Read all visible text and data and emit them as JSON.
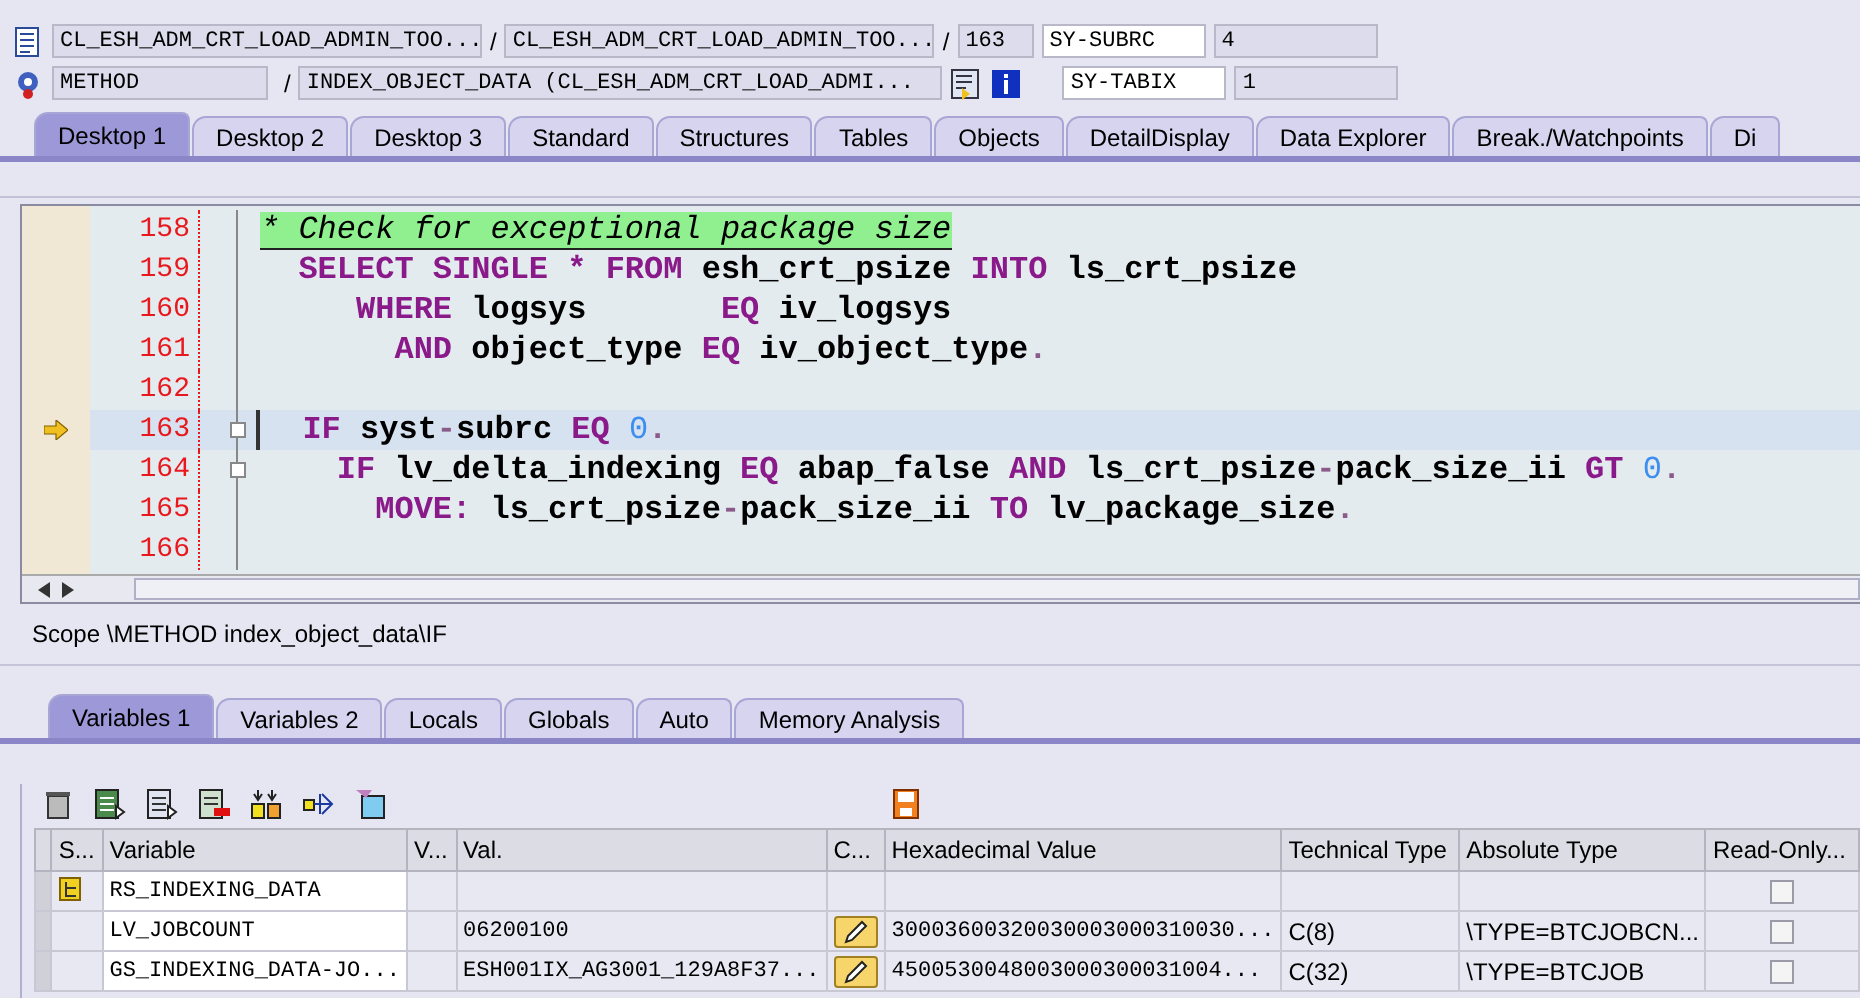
{
  "header": {
    "row1": {
      "class": "CL_ESH_ADM_CRT_LOAD_ADMIN_TOO...",
      "include": "CL_ESH_ADM_CRT_LOAD_ADMIN_TOO...",
      "line": "163",
      "sysfield": "SY-SUBRC",
      "sysvalue": "4"
    },
    "row2": {
      "type": "METHOD",
      "name": "INDEX_OBJECT_DATA (CL_ESH_ADM_CRT_LOAD_ADMI...",
      "sysfield": "SY-TABIX",
      "sysvalue": "1"
    },
    "separators": [
      "/",
      "/",
      "/"
    ]
  },
  "tabs": [
    {
      "label": "Desktop 1",
      "selected": true
    },
    {
      "label": "Desktop 2",
      "selected": false
    },
    {
      "label": "Desktop 3",
      "selected": false
    },
    {
      "label": "Standard",
      "selected": false
    },
    {
      "label": "Structures",
      "selected": false
    },
    {
      "label": "Tables",
      "selected": false
    },
    {
      "label": "Objects",
      "selected": false
    },
    {
      "label": "DetailDisplay",
      "selected": false
    },
    {
      "label": "Data Explorer",
      "selected": false
    },
    {
      "label": "Break./Watchpoints",
      "selected": false
    },
    {
      "label": "Di",
      "selected": false
    }
  ],
  "code": [
    {
      "number": "158",
      "current": false,
      "fold": false,
      "segments": [
        {
          "kind": "comment",
          "text": "* Check for exceptional package size"
        }
      ]
    },
    {
      "number": "159",
      "current": false,
      "fold": false,
      "segments": [
        {
          "kind": "kw",
          "text": "  SELECT SINGLE * FROM"
        },
        {
          "kind": "id",
          "text": " esh_crt_psize "
        },
        {
          "kind": "kw",
          "text": "INTO"
        },
        {
          "kind": "id",
          "text": " ls_crt_psize"
        }
      ]
    },
    {
      "number": "160",
      "current": false,
      "fold": false,
      "segments": [
        {
          "kind": "kw",
          "text": "     WHERE"
        },
        {
          "kind": "id",
          "text": " logsys       "
        },
        {
          "kind": "kw",
          "text": "EQ"
        },
        {
          "kind": "id",
          "text": " iv_logsys"
        }
      ]
    },
    {
      "number": "161",
      "current": false,
      "fold": false,
      "segments": [
        {
          "kind": "kw",
          "text": "       AND"
        },
        {
          "kind": "id",
          "text": " object_type "
        },
        {
          "kind": "kw",
          "text": "EQ"
        },
        {
          "kind": "id",
          "text": " iv_object_type"
        },
        {
          "kind": "op",
          "text": "."
        }
      ]
    },
    {
      "number": "162",
      "current": false,
      "fold": false
    },
    {
      "number": "163",
      "current": true,
      "fold": true,
      "segments": [
        {
          "kind": "kw",
          "text": "  IF"
        },
        {
          "kind": "id",
          "text": " syst"
        },
        {
          "kind": "op",
          "text": "-"
        },
        {
          "kind": "id",
          "text": "subrc "
        },
        {
          "kind": "kw",
          "text": "EQ"
        },
        {
          "kind": "num",
          "text": " 0"
        },
        {
          "kind": "op",
          "text": "."
        }
      ]
    },
    {
      "number": "164",
      "current": false,
      "fold": true,
      "segments": [
        {
          "kind": "kw",
          "text": "    IF"
        },
        {
          "kind": "id",
          "text": " lv_delta_indexing "
        },
        {
          "kind": "kw",
          "text": "EQ"
        },
        {
          "kind": "id",
          "text": " abap_false "
        },
        {
          "kind": "kw",
          "text": "AND"
        },
        {
          "kind": "id",
          "text": " ls_crt_psize"
        },
        {
          "kind": "op",
          "text": "-"
        },
        {
          "kind": "id",
          "text": "pack_size_ii "
        },
        {
          "kind": "kw",
          "text": "GT"
        },
        {
          "kind": "num",
          "text": " 0"
        },
        {
          "kind": "op",
          "text": "."
        }
      ]
    },
    {
      "number": "165",
      "current": false,
      "fold": false,
      "segments": [
        {
          "kind": "kw",
          "text": "      MOVE:"
        },
        {
          "kind": "id",
          "text": " ls_crt_psize"
        },
        {
          "kind": "op",
          "text": "-"
        },
        {
          "kind": "id",
          "text": "pack_size_ii "
        },
        {
          "kind": "kw",
          "text": "TO"
        },
        {
          "kind": "id",
          "text": " lv_package_size"
        },
        {
          "kind": "op",
          "text": "."
        }
      ]
    },
    {
      "number": "166",
      "current": false,
      "fold": false
    }
  ],
  "scope": "Scope \\METHOD index_object_data\\IF",
  "var_tabs": [
    {
      "label": "Variables 1",
      "selected": true
    },
    {
      "label": "Variables 2",
      "selected": false
    },
    {
      "label": "Locals",
      "selected": false
    },
    {
      "label": "Globals",
      "selected": false
    },
    {
      "label": "Auto",
      "selected": false
    },
    {
      "label": "Memory Analysis",
      "selected": false
    }
  ],
  "table": {
    "columns": [
      "S...",
      "Variable",
      "V...",
      "Val.",
      "C...",
      "Hexadecimal Value",
      "Technical Type",
      "Absolute Type",
      "Read-Only..."
    ],
    "rows": [
      {
        "structure": true,
        "variable": "RS_INDEXING_DATA",
        "v": "",
        "value": "",
        "edit": false,
        "hex": "",
        "technical_type": "",
        "absolute_type": "",
        "read_only": false
      },
      {
        "structure": false,
        "variable": "LV_JOBCOUNT",
        "v": "",
        "value": "06200100",
        "edit": true,
        "hex": "30003600320030003000310030...",
        "technical_type": "C(8)",
        "absolute_type": "\\TYPE=BTCJOBCN...",
        "read_only": false
      },
      {
        "structure": false,
        "variable": "GS_INDEXING_DATA-JO...",
        "v": "",
        "value": "ESH001IX_AG3001_129A8F37...",
        "edit": true,
        "hex": "4500530048003000300031004...",
        "technical_type": "C(32)",
        "absolute_type": "\\TYPE=BTCJOB",
        "read_only": false
      }
    ]
  }
}
